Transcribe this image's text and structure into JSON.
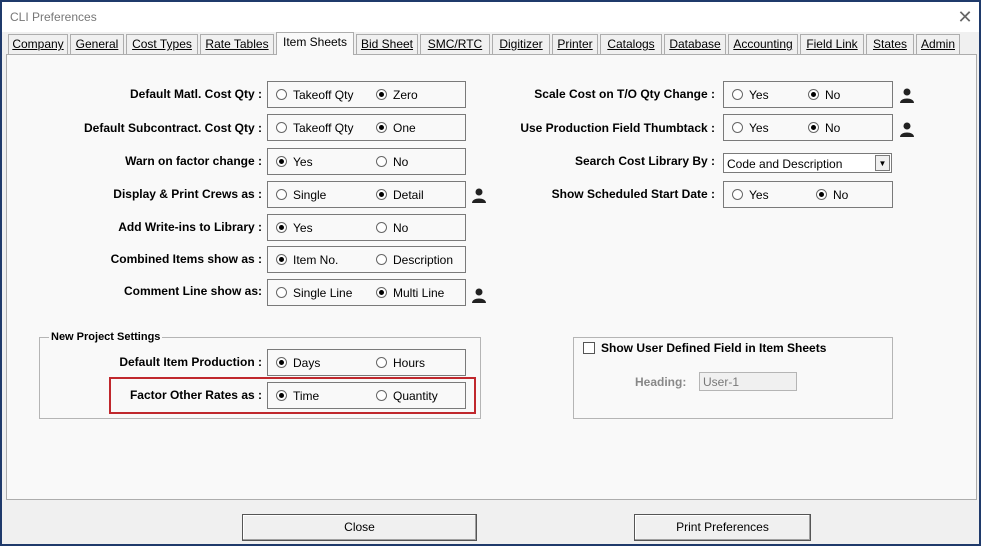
{
  "window": {
    "title": "CLI Preferences",
    "close_glyph": "✕"
  },
  "tabs": [
    "Company",
    "General",
    "Cost Types",
    "Rate Tables",
    "Item Sheets",
    "Bid Sheet",
    "SMC/RTC",
    "Digitizer",
    "Printer",
    "Catalogs",
    "Database",
    "Accounting",
    "Field Link",
    "States",
    "Admin"
  ],
  "active_tab": "Item Sheets",
  "left": {
    "matl_cost_qty": {
      "label": "Default Matl. Cost Qty :",
      "opt1": "Takeoff Qty",
      "opt2": "Zero",
      "selected": "Zero"
    },
    "subcontract_cost_qty": {
      "label": "Default Subcontract. Cost Qty :",
      "opt1": "Takeoff Qty",
      "opt2": "One",
      "selected": "One"
    },
    "warn_factor": {
      "label": "Warn on factor change :",
      "opt1": "Yes",
      "opt2": "No",
      "selected": "Yes"
    },
    "display_crews": {
      "label": "Display & Print Crews as :",
      "opt1": "Single",
      "opt2": "Detail",
      "selected": "Detail"
    },
    "write_ins": {
      "label": "Add Write-ins to Library :",
      "opt1": "Yes",
      "opt2": "No",
      "selected": "Yes"
    },
    "combined_items": {
      "label": "Combined Items show as :",
      "opt1": "Item No.",
      "opt2": "Description",
      "selected": "Item No."
    },
    "comment_line": {
      "label": "Comment Line show as:",
      "opt1": "Single Line",
      "opt2": "Multi Line",
      "selected": "Multi Line"
    }
  },
  "new_project": {
    "title": "New Project Settings",
    "item_production": {
      "label": "Default Item Production :",
      "opt1": "Days",
      "opt2": "Hours",
      "selected": "Days"
    },
    "factor_rates": {
      "label": "Factor Other Rates as :",
      "opt1": "Time",
      "opt2": "Quantity",
      "selected": "Time"
    }
  },
  "right": {
    "scale_cost": {
      "label": "Scale Cost on T/O Qty Change :",
      "opt1": "Yes",
      "opt2": "No",
      "selected": "No"
    },
    "thumbtack": {
      "label": "Use Production Field Thumbtack :",
      "opt1": "Yes",
      "opt2": "No",
      "selected": "No"
    },
    "search_library": {
      "label": "Search Cost Library By :",
      "value": "Code and Description"
    },
    "start_date": {
      "label": "Show Scheduled Start Date :",
      "opt1": "Yes",
      "opt2": "No",
      "selected": "No"
    }
  },
  "user_defined": {
    "checkbox_label": "Show User Defined Field in Item Sheets",
    "checked": false,
    "heading_label": "Heading:",
    "heading_value": "User-1"
  },
  "buttons": {
    "close": "Close",
    "print": "Print Preferences"
  },
  "colors": {
    "frame": "#1f3a6b",
    "highlight": "#c0282d"
  }
}
